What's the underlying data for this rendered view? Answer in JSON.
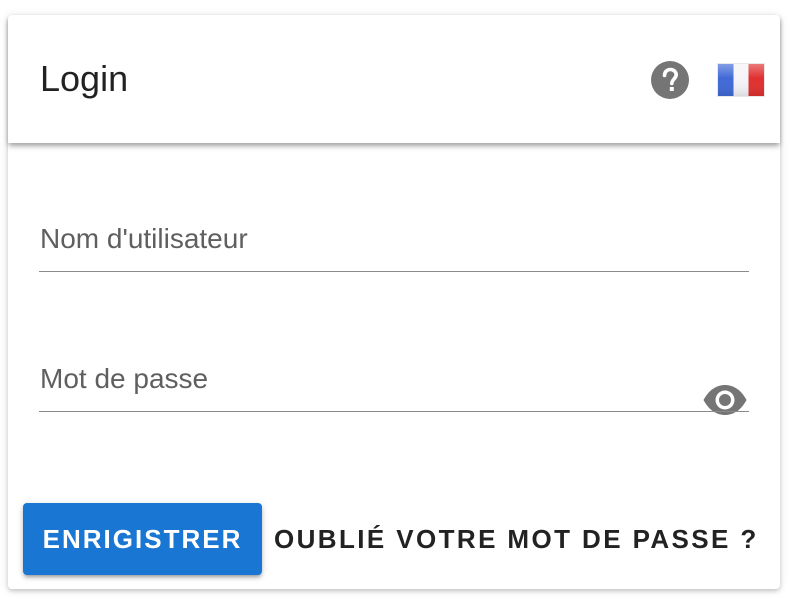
{
  "header": {
    "title": "Login",
    "help_icon": "help-circle-icon",
    "language_icon": "france-flag-icon"
  },
  "form": {
    "username": {
      "label": "Nom d'utilisateur",
      "value": ""
    },
    "password": {
      "label": "Mot de passe",
      "value": "",
      "toggle_icon": "eye-icon"
    }
  },
  "actions": {
    "register_label": "ENRIGISTRER",
    "forgot_label": "OUBLIÉ VOTRE MOT DE PASSE ?"
  },
  "colors": {
    "primary": "#1976d2",
    "icon_gray": "#757575",
    "text": "#222222",
    "label": "#5f5f5f"
  }
}
